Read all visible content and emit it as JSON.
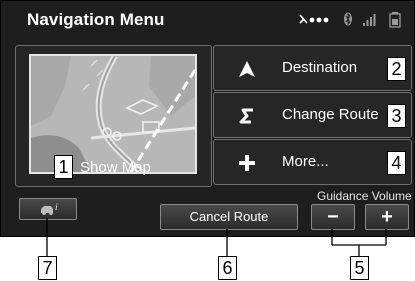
{
  "header": {
    "title": "Navigation Menu"
  },
  "status_icons": [
    "voice-dots-icon",
    "bluetooth-icon",
    "signal-bars-icon",
    "battery-icon"
  ],
  "map_tile": {
    "label": "Show Map",
    "callout": "1"
  },
  "menu_buttons": [
    {
      "label": "Destination",
      "icon": "arrow-up-icon",
      "callout": "2"
    },
    {
      "label": "Change Route",
      "icon": "route-s-icon",
      "callout": "3"
    },
    {
      "label": "More...",
      "icon": "plus-icon",
      "callout": "4"
    }
  ],
  "info_button": {
    "icon": "car-info-icon",
    "callout": "7"
  },
  "cancel_route": {
    "label": "Cancel Route",
    "callout": "6"
  },
  "guidance_volume": {
    "label": "Guidance Volume",
    "minus": "−",
    "plus": "+",
    "callout": "5"
  }
}
